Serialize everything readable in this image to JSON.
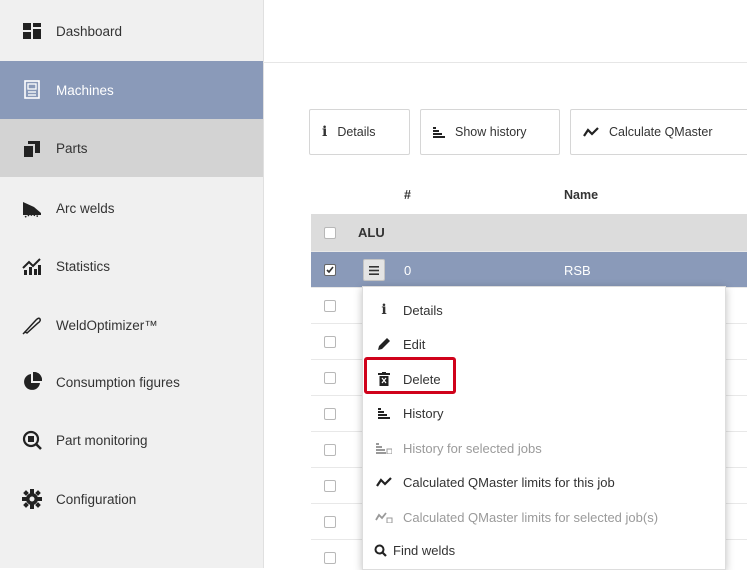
{
  "sidebar": {
    "items": [
      {
        "label": "Dashboard",
        "icon": "dashboard-icon"
      },
      {
        "label": "Machines",
        "icon": "machine-icon"
      },
      {
        "label": "Parts",
        "icon": "parts-icon"
      },
      {
        "label": "Arc welds",
        "icon": "arc-weld-icon"
      },
      {
        "label": "Statistics",
        "icon": "statistics-icon"
      },
      {
        "label": "WeldOptimizer™",
        "icon": "weld-optimizer-icon"
      },
      {
        "label": "Consumption figures",
        "icon": "pie-chart-icon"
      },
      {
        "label": "Part monitoring",
        "icon": "monitoring-icon"
      },
      {
        "label": "Configuration",
        "icon": "gear-icon"
      }
    ],
    "active_item": "Machines",
    "hover_item": "Parts"
  },
  "toolbar": {
    "details_label": "Details",
    "history_label": "Show history",
    "qmaster_label": "Calculate QMaster"
  },
  "table": {
    "headers": {
      "num": "#",
      "name": "Name"
    },
    "group_label": "ALU",
    "selected_row": {
      "num": "0",
      "name": "RSB"
    }
  },
  "context_menu": {
    "items": [
      {
        "label": "Details",
        "icon": "info-icon",
        "enabled": true
      },
      {
        "label": "Edit",
        "icon": "pencil-icon",
        "enabled": true
      },
      {
        "label": "Delete",
        "icon": "trash-icon",
        "enabled": true
      },
      {
        "label": "History",
        "icon": "history-icon",
        "enabled": true
      },
      {
        "label": "History for selected jobs",
        "icon": "history-selected-icon",
        "enabled": false
      },
      {
        "label": "Calculated QMaster limits for this job",
        "icon": "trend-icon",
        "enabled": true
      },
      {
        "label": "Calculated QMaster limits for selected job(s)",
        "icon": "trend-selected-icon",
        "enabled": false
      },
      {
        "label": "Find welds",
        "icon": "search-icon",
        "enabled": true
      }
    ],
    "highlighted_item": "Delete"
  },
  "colors": {
    "active_nav": "#8a9ab9",
    "hover_nav": "#d3d3d3",
    "highlight_border": "#d0021b"
  }
}
